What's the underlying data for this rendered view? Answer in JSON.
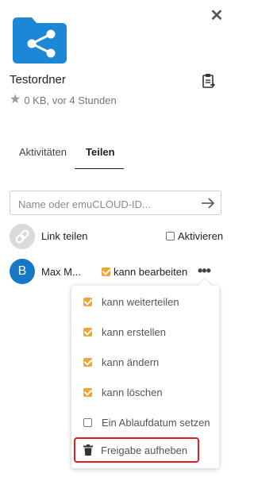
{
  "folder": {
    "name": "Testordner",
    "meta": "0 KB, vor 4 Stunden"
  },
  "tabs": [
    {
      "label": "Aktivitäten",
      "active": false
    },
    {
      "label": "Teilen",
      "active": true
    }
  ],
  "share_input": {
    "placeholder": "Name oder emuCLOUD-ID...",
    "value": ""
  },
  "link_share": {
    "label": "Link teilen",
    "activate_label": "Aktivieren",
    "activated": false
  },
  "share_entry": {
    "avatar_initial": "B",
    "user": "Max M...",
    "can_edit_label": "kann bearbeiten",
    "can_edit": true
  },
  "menu": {
    "items": [
      {
        "label": "kann weiterteilen",
        "checked": true
      },
      {
        "label": "kann erstellen",
        "checked": true
      },
      {
        "label": "kann ändern",
        "checked": true
      },
      {
        "label": "kann löschen",
        "checked": true
      },
      {
        "label": "Ein Ablaufdatum setzen",
        "checked": false
      }
    ],
    "unshare_label": "Freigabe aufheben"
  },
  "colors": {
    "folder_blue": "#1b87d6",
    "accent_orange": "#f2a531",
    "avatar_blue": "#1677c6",
    "highlight_red": "#e31b23"
  }
}
